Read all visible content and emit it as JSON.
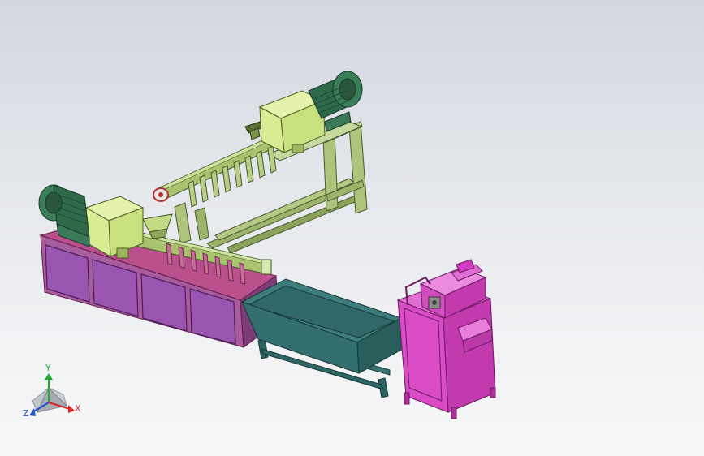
{
  "colors": {
    "background_top": "#d2d6de",
    "background_bottom": "#f7f7f8",
    "motor_green": "#2f6b4c",
    "gearbox_yellow": "#d8ee8a",
    "extruder_green": "#a7c06f",
    "cabinet_purple": "#9b4fa3",
    "tank_teal": "#2f6b6b",
    "pelletizer_magenta": "#d23dc4",
    "axis_x": "#d8262a",
    "axis_y": "#1fae2f",
    "axis_z": "#2451d1"
  },
  "triad": {
    "x_label": "X",
    "y_label": "Y",
    "z_label": "Z"
  }
}
